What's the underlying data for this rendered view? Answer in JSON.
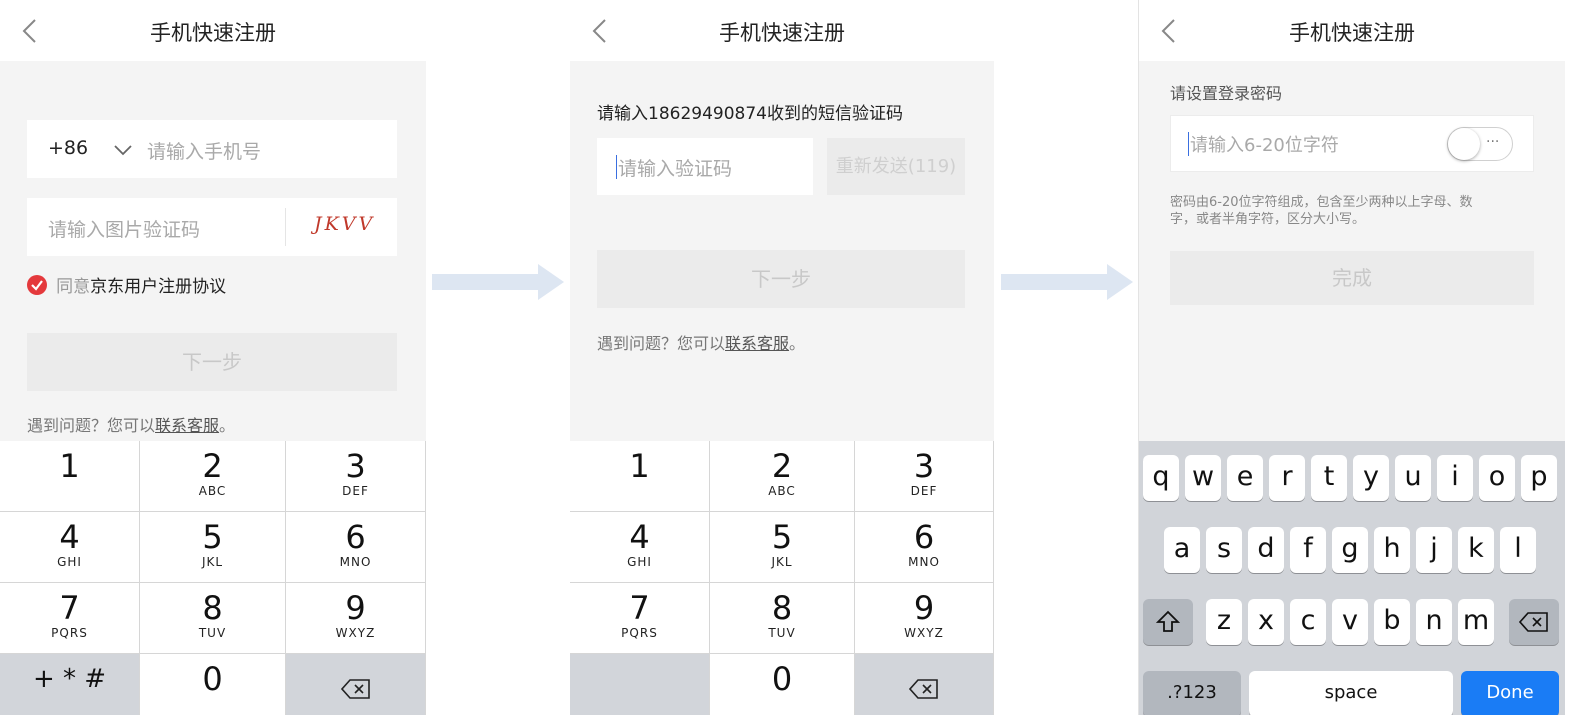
{
  "nav_title": "手机快速注册",
  "screen1": {
    "country_code": "+86",
    "phone_placeholder": "请输入手机号",
    "captcha_placeholder": "请输入图片验证码",
    "captcha_image_text": "JKVV",
    "agree_prefix": "同意",
    "agree_link": "京东用户注册协议",
    "next_label": "下一步",
    "help_prefix": "遇到问题？您可以",
    "help_link": "联系客服",
    "help_suffix": "。"
  },
  "screen2": {
    "instruction": "请输入18629490874收到的短信验证码",
    "code_placeholder": "请输入验证码",
    "resend_label": "重新发送(119)",
    "next_label": "下一步",
    "help_prefix": "遇到问题？您可以",
    "help_link": "联系客服",
    "help_suffix": "。"
  },
  "screen3": {
    "section_title": "请设置登录密码",
    "password_placeholder": "请输入6-20位字符",
    "toggle_label": "···",
    "rule_line1": "密码由6-20位字符组成，包含至少两种以上字母、数",
    "rule_line2": "字，或者半角字符，区分大小写。",
    "done_label": "完成"
  },
  "numpad": {
    "keys": [
      {
        "digit": "1",
        "letters": ""
      },
      {
        "digit": "2",
        "letters": "ABC"
      },
      {
        "digit": "3",
        "letters": "DEF"
      },
      {
        "digit": "4",
        "letters": "GHI"
      },
      {
        "digit": "5",
        "letters": "JKL"
      },
      {
        "digit": "6",
        "letters": "MNO"
      },
      {
        "digit": "7",
        "letters": "PQRS"
      },
      {
        "digit": "8",
        "letters": "TUV"
      },
      {
        "digit": "9",
        "letters": "WXYZ"
      }
    ],
    "symbols": "+ * #",
    "zero": "0",
    "delete_icon": "backspace-icon"
  },
  "keyboard": {
    "row1": [
      "q",
      "w",
      "e",
      "r",
      "t",
      "y",
      "u",
      "i",
      "o",
      "p"
    ],
    "row2": [
      "a",
      "s",
      "d",
      "f",
      "g",
      "h",
      "j",
      "k",
      "l"
    ],
    "row3": [
      "z",
      "x",
      "c",
      "v",
      "b",
      "n",
      "m"
    ],
    "numbers_key": ".?123",
    "space_key": "space",
    "done_key": "Done",
    "shift_icon": "shift-icon",
    "delete_icon": "backspace-icon"
  },
  "colors": {
    "check_red": "#e4393c",
    "arrow": "#dde6f2",
    "done_blue": "#1a7cf5"
  }
}
